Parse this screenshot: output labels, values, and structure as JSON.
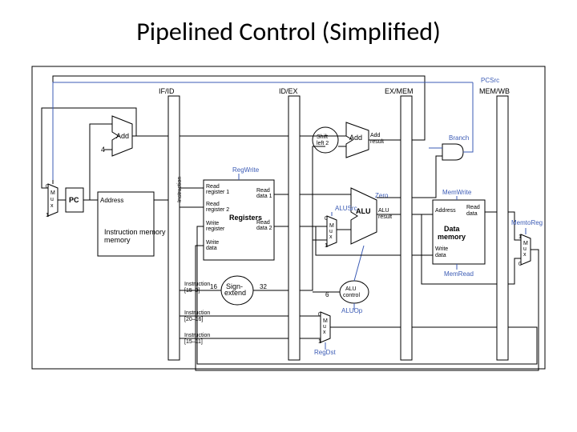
{
  "title": "Pipelined Control (Simplified)",
  "pipeline_registers": {
    "r0": "IF/ID",
    "r1": "ID/EX",
    "r2": "EX/MEM",
    "r3": "MEM/WB"
  },
  "blocks": {
    "pc": "PC",
    "imem": "Instruction\nmemory",
    "adder1": "Add",
    "adder2": "Add",
    "add_result": "Add\nresult",
    "regfile": "Registers",
    "sign_ext": "Sign-\nextend",
    "shift": "Shift\nleft 2",
    "alu": "ALU",
    "alu_result": "ALU\nresult",
    "alu_ctrl": "ALU\ncontrol",
    "dmem": "Data\nmemory",
    "mux": "M\nu\nx",
    "and": ""
  },
  "ports": {
    "imem_addr": "Address",
    "reg_rd1": "Read\nregister 1",
    "reg_rd2": "Read\nregister 2",
    "reg_wr": "Write\nregister",
    "reg_wd": "Write\ndata",
    "reg_d1": "Read\ndata 1",
    "reg_d2": "Read\ndata 2",
    "dmem_addr": "Address",
    "dmem_rd": "Read\ndata",
    "dmem_wd": "Write\ndata",
    "inst_15_0": "Instruction\n[15–0]",
    "inst_20_16": "Instruction\n[20–16]",
    "inst_15_11": "Instruction\n[15–11]",
    "inst": "Instruction"
  },
  "signals": {
    "pcsrc": "PCSrc",
    "regwrite": "RegWrite",
    "alusrc": "ALUSrc",
    "aluop": "ALUOp",
    "regdst": "RegDst",
    "branch": "Branch",
    "memwrite": "MemWrite",
    "memread": "MemRead",
    "zero": "Zero",
    "memtoreg": "MemtoReg"
  },
  "constants": {
    "four": "4",
    "sixteen": "16",
    "thirtytwo": "32",
    "six": "6",
    "mux0": "0",
    "mux1": "1"
  }
}
